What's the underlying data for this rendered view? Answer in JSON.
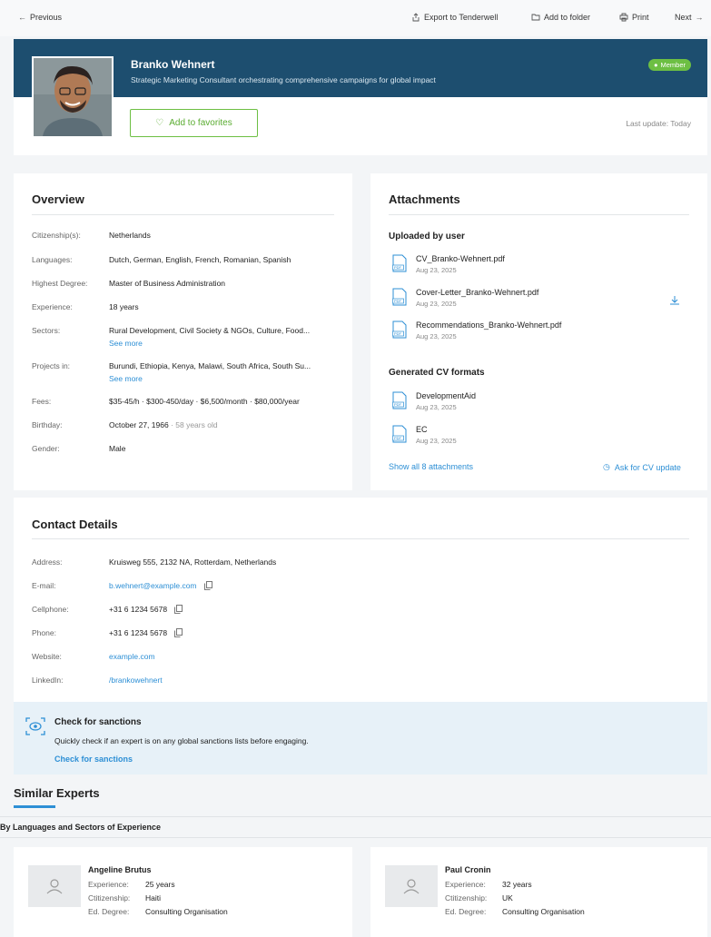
{
  "topbar": {
    "previous": "Previous",
    "export": "Export to Tenderwell",
    "add_folder": "Add to folder",
    "print": "Print",
    "next": "Next"
  },
  "profile": {
    "name": "Branko Wehnert",
    "tagline": "Strategic Marketing Consultant orchestrating comprehensive campaigns for global impact",
    "badge": "Member",
    "favorites": "Add to favorites",
    "last_update": "Last update: Today"
  },
  "overview": {
    "title": "Overview",
    "rows": [
      {
        "label": "Citizenship(s):",
        "value": "Netherlands"
      },
      {
        "label": "Languages:",
        "value": "Dutch, German, English, French, Romanian, Spanish"
      },
      {
        "label": "Highest Degree:",
        "value": "Master of Business Administration"
      },
      {
        "label": "Experience:",
        "value": "18 years"
      },
      {
        "label": "Sectors:",
        "value": "Rural Development, Civil Society & NGOs, Culture, Food...",
        "more": "See more"
      },
      {
        "label": "Projects in:",
        "value": "Burundi, Ethiopia, Kenya, Malawi, South Africa, South Su...",
        "more": "See more"
      },
      {
        "label": "Fees:",
        "value": "$35-45/h · $300-450/day · $6,500/month · $80,000/year"
      },
      {
        "label": "Birthday:",
        "value": "October 27, 1966",
        "extra": "· 58 years old"
      },
      {
        "label": "Gender:",
        "value": "Male"
      }
    ]
  },
  "attachments": {
    "title": "Attachments",
    "uploaded_title": "Uploaded by user",
    "uploaded": [
      {
        "name": "CV_Branko-Wehnert.pdf",
        "date": "Aug 23, 2025"
      },
      {
        "name": "Cover-Letter_Branko-Wehnert.pdf",
        "date": "Aug 23, 2025"
      },
      {
        "name": "Recommendations_Branko-Wehnert.pdf",
        "date": "Aug 23, 2025"
      }
    ],
    "generated_title": "Generated CV formats",
    "generated": [
      {
        "name": "DevelopmentAid",
        "date": "Aug 23, 2025"
      },
      {
        "name": "EC",
        "date": "Aug 23, 2025"
      }
    ],
    "show_all": "Show all 8 attachments",
    "ask_update": "Ask for CV update",
    "pdf_tag": "PDF"
  },
  "contact": {
    "title": "Contact Details",
    "address_label": "Address:",
    "address": "Kruisweg 555, 2132 NA, Rotterdam, Netherlands",
    "email_label": "E-mail:",
    "email": "b.wehnert@example.com",
    "cell_label": "Cellphone:",
    "cell": "+31 6 1234 5678",
    "phone_label": "Phone:",
    "phone": "+31 6 1234 5678",
    "website_label": "Website:",
    "website": "example.com",
    "linkedin_label": "LinkedIn:",
    "linkedin": "/brankowehnert"
  },
  "sanctions": {
    "title": "Check for sanctions",
    "text": "Quickly check if an expert is on any global sanctions lists before engaging.",
    "link": "Check for sanctions"
  },
  "similar": {
    "title": "Similar Experts",
    "subtitle": "By Languages and Sectors of Experience",
    "labels": {
      "experience": "Experience:",
      "citizenship": "Ctitizenship:",
      "degree": "Ed. Degree:"
    },
    "experts": [
      {
        "name": "Angeline Brutus",
        "experience": "25 years",
        "citizenship": "Haiti",
        "degree": "Consulting Organisation"
      },
      {
        "name": "Paul Cronin",
        "experience": "32 years",
        "citizenship": "UK",
        "degree": "Consulting Organisation"
      }
    ]
  },
  "colors": {
    "brand": "#1d4e6f",
    "accent": "#6dbf43",
    "link": "#2d8fd5"
  }
}
